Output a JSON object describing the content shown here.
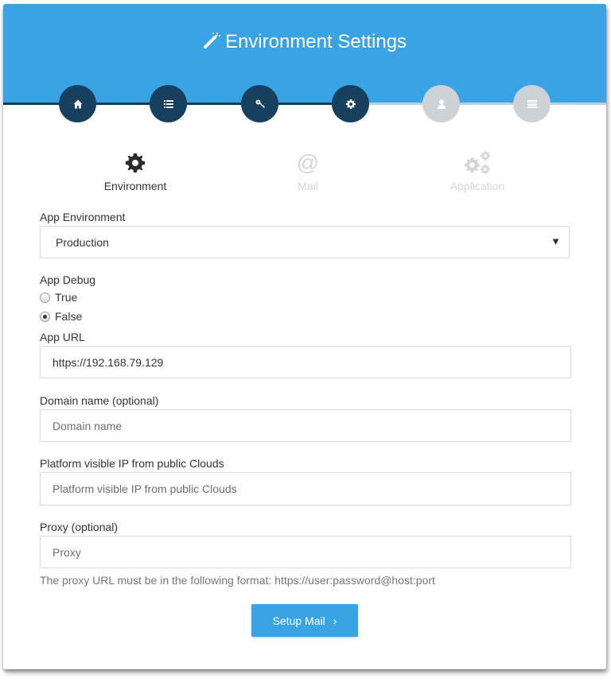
{
  "header": {
    "title": "Environment Settings",
    "icon": "magic-wand-icon",
    "color": "#3aa3e3"
  },
  "progress": {
    "steps": [
      {
        "icon": "home-icon",
        "status": "done"
      },
      {
        "icon": "list-icon",
        "status": "done"
      },
      {
        "icon": "key-icon",
        "status": "done"
      },
      {
        "icon": "gear-icon",
        "status": "done"
      },
      {
        "icon": "user-icon",
        "status": "todo"
      },
      {
        "icon": "server-icon",
        "status": "todo"
      }
    ],
    "done_color": "#17405e",
    "todo_color": "#cdd2d6"
  },
  "tabs": [
    {
      "label": "Environment",
      "icon": "gear-icon",
      "active": true
    },
    {
      "label": "Mail",
      "icon": "at-sign-icon",
      "active": false
    },
    {
      "label": "Application",
      "icon": "gears-icon",
      "active": false
    }
  ],
  "form": {
    "app_environment": {
      "label": "App Environment",
      "value": "Production"
    },
    "app_debug": {
      "label": "App Debug",
      "options": [
        "True",
        "False"
      ],
      "selected": "False"
    },
    "app_url": {
      "label": "App URL",
      "value": "https://192.168.79.129"
    },
    "domain_name": {
      "label": "Domain name (optional)",
      "placeholder": "Domain name",
      "value": ""
    },
    "platform_ip": {
      "label": "Platform visible IP from public Clouds",
      "placeholder": "Platform visible IP from public Clouds",
      "value": ""
    },
    "proxy": {
      "label": "Proxy (optional)",
      "placeholder": "Proxy",
      "value": ""
    },
    "proxy_help": "The proxy URL must be in the following format: https://user:password@host:port"
  },
  "actions": {
    "next_label": "Setup Mail",
    "next_icon": "chevron-right-icon"
  }
}
